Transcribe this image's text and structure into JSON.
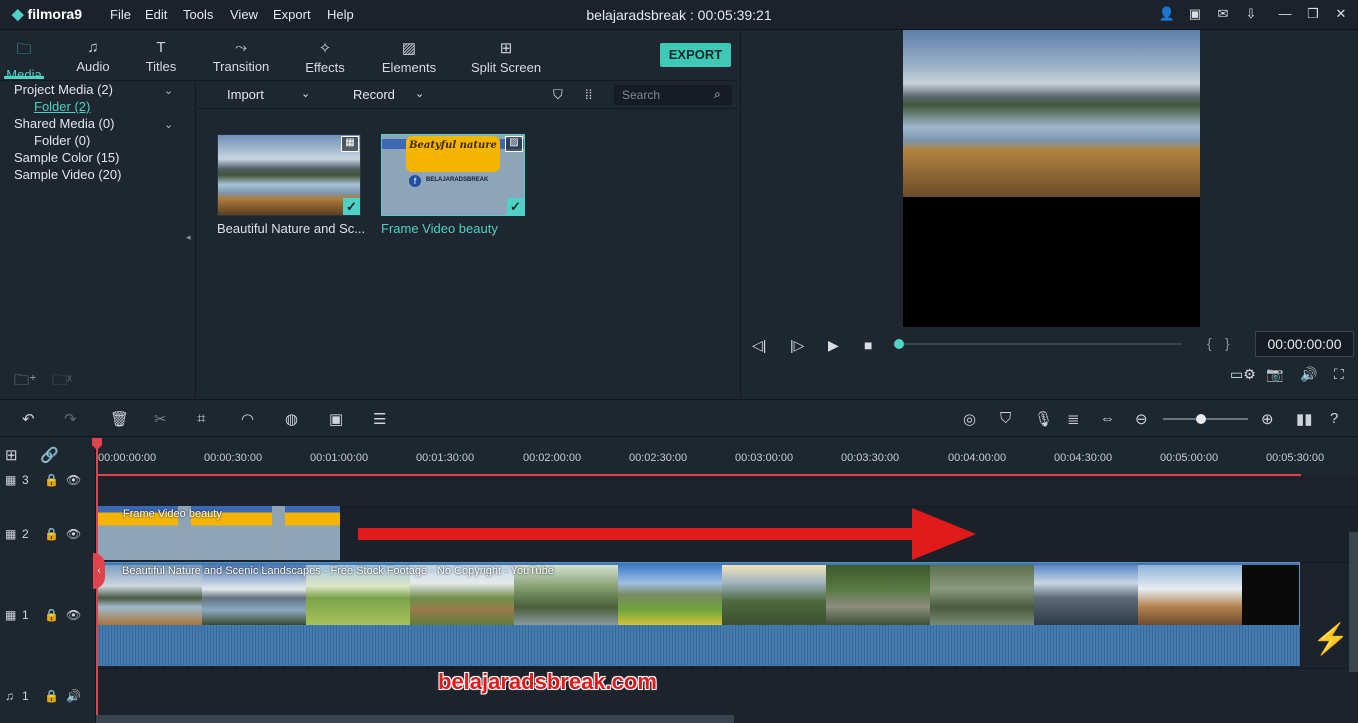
{
  "app": {
    "logo": "filmora9",
    "project_title": "belajaradsbreak : 00:05:39:21"
  },
  "menu": [
    "File",
    "Edit",
    "Tools",
    "View",
    "Export",
    "Help"
  ],
  "tabs": [
    {
      "label": "Media",
      "icon": "folder-icon"
    },
    {
      "label": "Audio",
      "icon": "music-note-icon"
    },
    {
      "label": "Titles",
      "icon": "text-icon"
    },
    {
      "label": "Transition",
      "icon": "transition-icon"
    },
    {
      "label": "Effects",
      "icon": "effects-icon"
    },
    {
      "label": "Elements",
      "icon": "image-icon"
    },
    {
      "label": "Split Screen",
      "icon": "split-screen-icon"
    }
  ],
  "export_label": "EXPORT",
  "library": {
    "project_media": "Project Media (2)",
    "folder_selected": "Folder (2)",
    "shared_media": "Shared Media (0)",
    "folder_shared": "Folder (0)",
    "sample_color": "Sample Color (15)",
    "sample_video": "Sample Video (20)"
  },
  "media_toolbar": {
    "import": "Import",
    "record": "Record",
    "search_placeholder": "Search"
  },
  "media_items": [
    {
      "name": "Beautiful Nature and Sc...",
      "type": "video"
    },
    {
      "name": "Frame Video beauty",
      "type": "image",
      "thumb_title": "Beatyful nature",
      "thumb_channel": "BELAJARADSBREAK"
    }
  ],
  "player": {
    "timecode": "00:00:00:00",
    "progress": 0
  },
  "ruler_ticks": [
    "00:00:00:00",
    "00:00:30:00",
    "00:01:00:00",
    "00:01:30:00",
    "00:02:00:00",
    "00:02:30:00",
    "00:03:00:00",
    "00:03:30:00",
    "00:04:00:00",
    "00:04:30:00",
    "00:05:00:00",
    "00:05:30:00"
  ],
  "tracks": {
    "t3": "3",
    "t2": "2",
    "t1": "1",
    "audio": "1"
  },
  "clips": {
    "overlay": "Frame Video beauty",
    "main": "Beautiful Nature and Scenic Landscapes - Free Stock Footage - No Copyright - YouTube"
  },
  "watermark": "belajaradsbreak.com",
  "colors": {
    "accent": "#4fd1c5",
    "playhead": "#e0434c",
    "arrow": "#e11b1b"
  }
}
